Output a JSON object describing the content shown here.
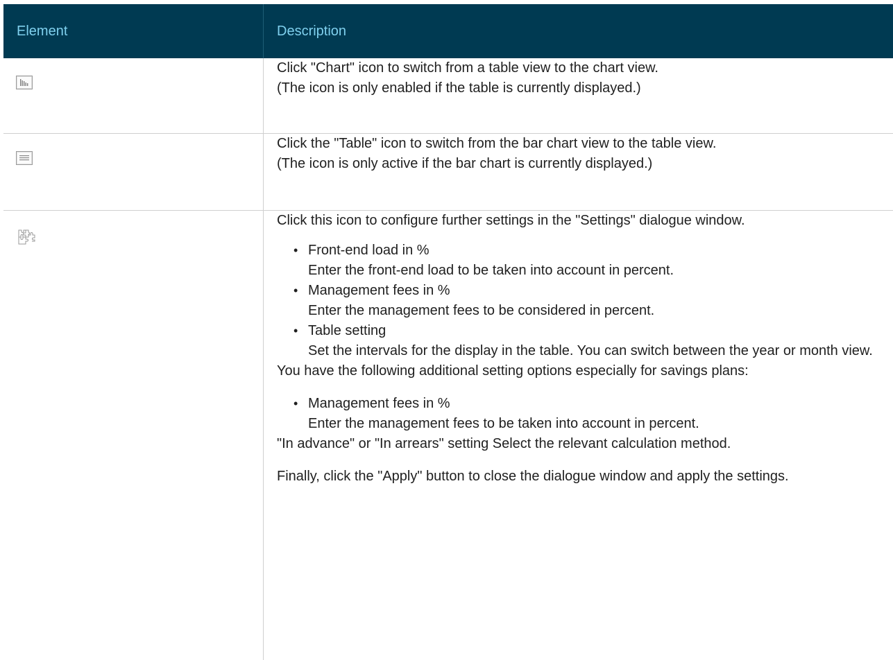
{
  "header": {
    "col1": "Element",
    "col2": "Description"
  },
  "rows": [
    {
      "icon": "bar-chart-icon",
      "lines": [
        "Click \"Chart\" icon to switch from a table view to the chart view.",
        "(The icon is only enabled if the table is currently displayed.)"
      ]
    },
    {
      "icon": "table-icon",
      "lines": [
        "Click the \"Table\" icon to switch from the bar chart view to the table view.",
        "(The icon is only active if the bar chart is currently displayed.)"
      ]
    },
    {
      "icon": "puzzle-icon",
      "intro": "Click this icon to configure further settings in the \"Settings\" dialogue window.",
      "bullets": [
        {
          "title": "Front-end load in %",
          "desc": "Enter the front-end load to be taken into account in percent."
        },
        {
          "title": "Management fees in %",
          "desc": "Enter the management fees to be considered in percent."
        },
        {
          "title": "Table setting",
          "desc": "Set the intervals for the display in the table. You can switch between the year or month view."
        }
      ],
      "additional": "You have the following additional setting options especially for savings plans:",
      "bullets2": [
        {
          "title": "Management fees in %",
          "desc": "Enter the management fees to be taken into account in percent."
        }
      ],
      "advance": "\"In advance\" or \"In arrears\" setting Select the relevant calculation method.",
      "final": "Finally, click the \"Apply\" button to close the dialogue window and apply the settings."
    }
  ]
}
